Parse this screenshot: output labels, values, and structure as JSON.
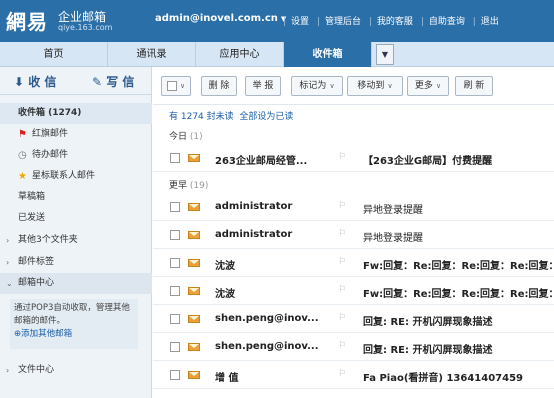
{
  "header": {
    "logo": "網易",
    "product": "企业邮箱",
    "domain": "qiye.163.com",
    "account": "admin@inovel.com.cn",
    "links": [
      "设置",
      "管理后台",
      "我的客服",
      "自助查询",
      "退出"
    ]
  },
  "tabs": [
    "首页",
    "通讯录",
    "应用中心",
    "收件箱"
  ],
  "sidebar": {
    "receive": "收 信",
    "compose": "写 信",
    "items": [
      {
        "label": "收件箱 (1274)"
      },
      {
        "label": "红旗邮件"
      },
      {
        "label": "待办邮件"
      },
      {
        "label": "星标联系人邮件"
      },
      {
        "label": "草稿箱"
      },
      {
        "label": "已发送"
      },
      {
        "label": "其他3个文件夹"
      },
      {
        "label": "邮件标签"
      },
      {
        "label": "邮箱中心"
      }
    ],
    "pop3_text": "通过POP3自动收取，管理其他邮箱的邮件。",
    "pop3_add": "添加其他邮箱",
    "file_center": "文件中心"
  },
  "toolbar": {
    "delete": "删 除",
    "report": "举 报",
    "mark_as": "标记为",
    "move_to": "移动到",
    "more": "更多",
    "refresh": "刷 新"
  },
  "summary": {
    "prefix": "有 1274 封未读",
    "mark_all": "全部设为已读"
  },
  "groups": {
    "today": "今日",
    "today_count": "(1)",
    "earlier": "更早",
    "earlier_count": "(19)"
  },
  "emails": [
    {
      "from": "263企业邮局经管...",
      "subject": "【263企业G邮局】付费提醒"
    },
    {
      "from": "administrator",
      "subject": "异地登录提醒"
    },
    {
      "from": "administrator",
      "subject": "异地登录提醒"
    },
    {
      "from": "沈波",
      "subject": "Fw:回复：Re:回复：Re:回复：Re:回复："
    },
    {
      "from": "沈波",
      "subject": "Fw:回复：Re:回复：Re:回复：Re:回复："
    },
    {
      "from": "shen.peng@inov...",
      "subject": "回复: RE: 开机闪屏现象描述"
    },
    {
      "from": "shen.peng@inov...",
      "subject": "回复: RE: 开机闪屏现象描述"
    },
    {
      "from": "增 值",
      "subject": "Fa Piao(看拼音) 13641407459"
    }
  ],
  "colors": {
    "header": "#2b6fa8",
    "accent": "#1a5fa8",
    "envelope": "#e8a23a"
  }
}
